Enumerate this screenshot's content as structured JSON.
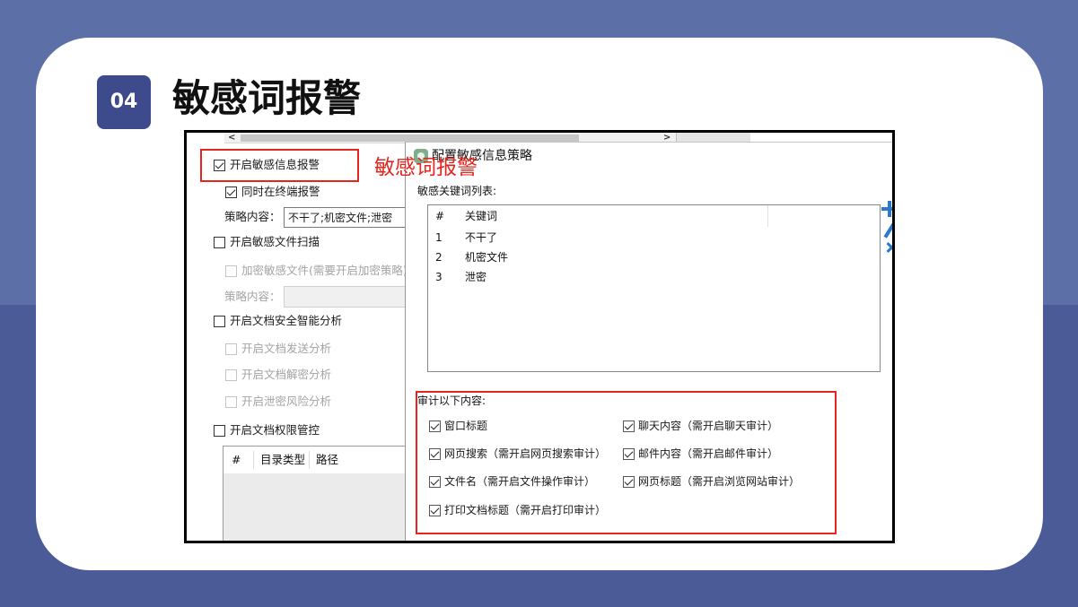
{
  "slide": {
    "badge": "04",
    "title": "敏感词报警",
    "annotation": "敏感词报警"
  },
  "colors": {
    "background_top": "#5d6fa7",
    "background_bottom": "#4a5b98",
    "badge": "#3d4b8c",
    "highlight_red": "#e4261f",
    "toolbar_blue": "#2a78d0"
  },
  "left_panel": {
    "scrollbar": {
      "left_arrow": "<",
      "right_arrow": ">"
    },
    "enable_sensitive_alert": {
      "label": "开启敏感信息报警",
      "checked": true,
      "disabled": false
    },
    "alert_on_terminal": {
      "label": "同时在终端报警",
      "checked": true,
      "disabled": false
    },
    "policy_content_1": {
      "label": "策略内容：",
      "value": "不干了;机密文件;泄密",
      "disabled": false
    },
    "enable_file_scan": {
      "label": "开启敏感文件扫描",
      "checked": false,
      "disabled": false
    },
    "encrypt_sensitive_files": {
      "label": "加密敏感文件(需要开启加密策略)",
      "checked": false,
      "disabled": true
    },
    "policy_content_2": {
      "label": "策略内容：",
      "disabled": true
    },
    "enable_doc_analysis": {
      "label": "开启文档安全智能分析",
      "checked": false,
      "disabled": false
    },
    "doc_send_analysis": {
      "label": "开启文档发送分析",
      "checked": false,
      "disabled": true
    },
    "doc_decrypt_analysis": {
      "label": "开启文档解密分析",
      "checked": false,
      "disabled": true
    },
    "leak_risk_analysis": {
      "label": "开启泄密风险分析",
      "checked": false,
      "disabled": true
    },
    "enable_doc_permission": {
      "label": "开启文档权限管控",
      "checked": false,
      "disabled": false
    },
    "directory_table": {
      "columns": [
        "#",
        "目录类型",
        "路径"
      ]
    }
  },
  "dialog": {
    "title": "配置敏感信息策略",
    "app_icon": "app-icon",
    "keyword_list_label": "敏感关键词列表:",
    "keyword_columns": [
      "#",
      "关键词"
    ],
    "keywords": [
      {
        "index": "1",
        "keyword": "不干了"
      },
      {
        "index": "2",
        "keyword": "机密文件"
      },
      {
        "index": "3",
        "keyword": "泄密"
      }
    ],
    "toolbar_icons": [
      "add-icon",
      "edit-icon",
      "delete-icon"
    ],
    "audit_label": "审计以下内容:",
    "audit_items": [
      {
        "label": "窗口标题",
        "checked": true
      },
      {
        "label": "聊天内容（需开启聊天审计）",
        "checked": true
      },
      {
        "label": "网页搜索（需开启网页搜索审计）",
        "checked": true
      },
      {
        "label": "邮件内容（需开启邮件审计）",
        "checked": true
      },
      {
        "label": "文件名（需开启文件操作审计）",
        "checked": true
      },
      {
        "label": "网页标题（需开启浏览网站审计）",
        "checked": true
      },
      {
        "label": "打印文档标题（需开启打印审计）",
        "checked": true
      }
    ]
  }
}
